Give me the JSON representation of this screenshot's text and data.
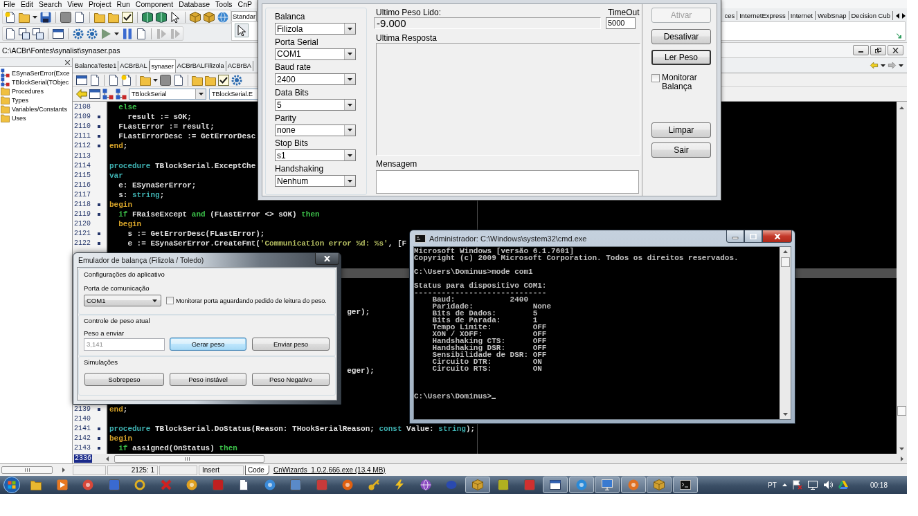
{
  "ide": {
    "menu": [
      "File",
      "Edit",
      "Search",
      "View",
      "Project",
      "Run",
      "Component",
      "Database",
      "Tools",
      "CnP"
    ],
    "palette": {
      "tabs_left": [
        {
          "label": "Standar",
          "selected": true
        }
      ],
      "tabs_right": [
        {
          "label": "ces",
          "selected": false
        },
        {
          "label": "InternetExpress",
          "selected": false
        },
        {
          "label": "Internet",
          "selected": false
        },
        {
          "label": "WebSnap",
          "selected": false
        },
        {
          "label": "Decision Cub",
          "selected": false
        }
      ]
    },
    "file_path": "C:\\ACBr\\Fontes\\synalist\\synaser.pas",
    "explorer_items": [
      {
        "label": "ESynaSerError(Exce",
        "kind": "class"
      },
      {
        "label": "TBlockSerial(TObjec",
        "kind": "class"
      },
      {
        "label": "Procedures",
        "kind": "folder"
      },
      {
        "label": "Types",
        "kind": "folder"
      },
      {
        "label": "Variables/Constants",
        "kind": "folder"
      },
      {
        "label": "Uses",
        "kind": "folder"
      }
    ],
    "editor_tabs": [
      {
        "label": "BalancaTeste1",
        "selected": false
      },
      {
        "label": "ACBrBAL",
        "selected": false
      },
      {
        "label": "synaser",
        "selected": true
      },
      {
        "label": "ACBrBALFilizola",
        "selected": false
      },
      {
        "label": "ACBrBA",
        "selected": false
      }
    ],
    "class_combo": "TBlockSerial",
    "method_combo": "TBlockSerial.E",
    "code": {
      "lines": [
        {
          "number": "2108",
          "marked": false,
          "current": false,
          "tokens": [
            {
              "text": "  else",
              "kind": "keyword"
            }
          ]
        },
        {
          "number": "2109",
          "marked": true,
          "current": false,
          "tokens": [
            {
              "text": "    result := sOK;",
              "kind": "plain"
            }
          ]
        },
        {
          "number": "2110",
          "marked": true,
          "current": false,
          "tokens": [
            {
              "text": "  FLastError := result;",
              "kind": "plain"
            }
          ]
        },
        {
          "number": "2111",
          "marked": true,
          "current": false,
          "tokens": [
            {
              "text": "  FLastErrorDesc := GetErrorDesc",
              "kind": "plain"
            }
          ]
        },
        {
          "number": "2112",
          "marked": true,
          "current": false,
          "tokens": [
            {
              "text": "end",
              "kind": "block"
            },
            {
              "text": ";",
              "kind": "plain"
            }
          ]
        },
        {
          "number": "2113",
          "marked": false,
          "current": false
        },
        {
          "number": "2114",
          "marked": false,
          "current": false,
          "tokens": [
            {
              "text": "procedure",
              "kind": "declaration"
            },
            {
              "text": " TBlockSerial.ExceptChe",
              "kind": "plain"
            }
          ]
        },
        {
          "number": "2115",
          "marked": false,
          "current": false,
          "tokens": [
            {
              "text": "var",
              "kind": "declaration"
            }
          ]
        },
        {
          "number": "2116",
          "marked": false,
          "current": false,
          "tokens": [
            {
              "text": "  e: ESynaSerError;",
              "kind": "plain"
            }
          ]
        },
        {
          "number": "2117",
          "marked": false,
          "current": false,
          "tokens": [
            {
              "text": "  s: ",
              "kind": "plain"
            },
            {
              "text": "string",
              "kind": "declaration"
            },
            {
              "text": ";",
              "kind": "plain"
            }
          ]
        },
        {
          "number": "2118",
          "marked": true,
          "current": false,
          "tokens": [
            {
              "text": "begin",
              "kind": "block"
            }
          ]
        },
        {
          "number": "2119",
          "marked": true,
          "current": false,
          "tokens": [
            {
              "text": "  if",
              "kind": "keyword"
            },
            {
              "text": " FRaiseExcept ",
              "kind": "plain"
            },
            {
              "text": "and",
              "kind": "keyword"
            },
            {
              "text": " (FLastError <> sOK) ",
              "kind": "plain"
            },
            {
              "text": "then",
              "kind": "keyword"
            }
          ]
        },
        {
          "number": "2120",
          "marked": false,
          "current": false,
          "tokens": [
            {
              "text": "  begin",
              "kind": "block"
            }
          ]
        },
        {
          "number": "2121",
          "marked": true,
          "current": false,
          "tokens": [
            {
              "text": "    s := GetErrorDesc(FLastError);",
              "kind": "plain"
            }
          ]
        },
        {
          "number": "2122",
          "marked": true,
          "current": false,
          "tokens": [
            {
              "text": "    e := ESynaSerError.CreateFmt(",
              "kind": "plain"
            },
            {
              "text": "'Communication error %d: %s'",
              "kind": "string"
            },
            {
              "text": ", [F",
              "kind": "plain"
            }
          ]
        },
        {
          "current": false
        },
        {
          "current": false
        },
        {
          "current": true
        },
        {
          "current": false
        },
        {
          "current": false
        },
        {
          "current": false
        },
        {
          "current": false,
          "tokens": [
            {
              "text": "                                                    ger);",
              "kind": "plain"
            }
          ]
        },
        {
          "current": false
        },
        {
          "current": false
        },
        {
          "current": false
        },
        {
          "current": false
        },
        {
          "current": false
        },
        {
          "current": false,
          "tokens": [
            {
              "text": "                                                    eger);",
              "kind": "plain"
            }
          ]
        },
        {
          "current": false
        },
        {
          "current": false
        },
        {
          "current": false
        },
        {
          "number": "2139",
          "marked": true,
          "current": false,
          "tokens": [
            {
              "text": "end",
              "kind": "block"
            },
            {
              "text": ";",
              "kind": "plain"
            }
          ]
        },
        {
          "number": "2140",
          "marked": false,
          "current": false
        },
        {
          "number": "2141",
          "marked": true,
          "current": false,
          "tokens": [
            {
              "text": "procedure",
              "kind": "declaration"
            },
            {
              "text": " TBlockSerial.DoStatus(Reason: THookSerialReason; ",
              "kind": "plain"
            },
            {
              "text": "const",
              "kind": "declaration"
            },
            {
              "text": " Value: ",
              "kind": "plain"
            },
            {
              "text": "string",
              "kind": "declaration"
            },
            {
              "text": ");",
              "kind": "plain"
            }
          ]
        },
        {
          "number": "2142",
          "marked": true,
          "current": false,
          "tokens": [
            {
              "text": "begin",
              "kind": "block"
            }
          ]
        },
        {
          "number": "2143",
          "marked": true,
          "current": false,
          "tokens": [
            {
              "text": "  if",
              "kind": "keyword"
            },
            {
              "text": " assigned(OnStatus) ",
              "kind": "plain"
            },
            {
              "text": "then",
              "kind": "keyword"
            }
          ]
        }
      ],
      "line_count": "2336"
    },
    "status_bar": {
      "position": "2125: 1",
      "mode": "Insert",
      "view_tab": "Code",
      "message": "CnWizards_1.0.2.666.exe (13.4 MB)"
    }
  },
  "balance_dialog": {
    "settings": [
      {
        "label": "Balanca",
        "value": "Filizola"
      },
      {
        "label": "Porta Serial",
        "value": "COM1"
      },
      {
        "label": "Baud rate",
        "value": "2400"
      },
      {
        "label": "Data Bits",
        "value": "5"
      },
      {
        "label": "Parity",
        "value": "none"
      },
      {
        "label": "Stop Bits",
        "value": "s1"
      },
      {
        "label": "Handshaking",
        "value": "Nenhum"
      }
    ],
    "last_weight": {
      "label": "Ultimo Peso Lido:",
      "value": "-9.000"
    },
    "timeout": {
      "label": "TimeOut",
      "value": "5000"
    },
    "last_response": {
      "label": "Ultima Resposta"
    },
    "message": {
      "label": "Mensagem"
    },
    "actions": [
      {
        "label": "Ativar",
        "disabled": true,
        "focused": false
      },
      {
        "label": "Desativar",
        "disabled": false,
        "focused": false
      },
      {
        "label": "Ler Peso",
        "disabled": false,
        "focused": true
      }
    ],
    "monitor": {
      "label": "Monitorar Balança",
      "checked": false
    },
    "bottom_actions": [
      {
        "label": "Limpar",
        "disabled": false,
        "focused": false
      },
      {
        "label": "Sair",
        "disabled": false,
        "focused": false
      }
    ]
  },
  "emulator": {
    "title": "Emulador de balança (Filizola / Toledo)",
    "app_settings": {
      "title": "Configurações do aplicativo",
      "port_label": "Porta de comunicação",
      "port": "COM1",
      "monitor": {
        "label": "Monitorar porta aguardando pedido de leitura do peso.",
        "checked": false
      }
    },
    "weight_control": {
      "title": "Controle de peso atual",
      "weight_label": "Peso a enviar",
      "weight": {
        "placeholder": "3,141"
      },
      "buttons": [
        {
          "label": "Gerar peso",
          "focused": true
        },
        {
          "label": "Enviar peso",
          "focused": false
        }
      ]
    },
    "simulations": {
      "title": "Simulações",
      "buttons": [
        {
          "label": "Sobrepeso",
          "focused": false
        },
        {
          "label": "Peso instável",
          "focused": false
        },
        {
          "label": "Peso Negativo",
          "focused": false
        }
      ]
    }
  },
  "console": {
    "title": "Administrador: C:\\Windows\\system32\\cmd.exe",
    "blocks": [
      [
        "Microsoft Windows [versão 6.1.7601]",
        "Copyright (c) 2009 Microsoft Corporation. Todos os direitos reservados."
      ],
      [
        "C:\\Users\\Dominus>mode com1"
      ],
      [
        "Status para dispositivo COM1:",
        "-----------------------------",
        "    Baud:            2400",
        "    Paridade:             None",
        "    Bits de Dados:        5",
        "    Bits de Parada:       1",
        "    Tempo Limite:         OFF",
        "    XON / XOFF:           OFF",
        "    Handshaking CTS:      OFF",
        "    Handshaking DSR:      OFF",
        "    Sensibilidade de DSR: OFF",
        "    Circuito DTR:         ON",
        "    Circuito RTS:         ON"
      ]
    ],
    "prompt": "C:\\Users\\Dominus>"
  },
  "taskbar": {
    "apps": [
      {
        "open": false
      },
      {
        "open": false
      },
      {
        "open": false
      },
      {
        "open": false
      },
      {
        "open": false
      },
      {
        "open": false
      },
      {
        "open": false
      },
      {
        "open": false
      },
      {
        "open": false
      },
      {
        "open": false
      },
      {
        "open": false
      },
      {
        "open": false
      },
      {
        "open": false
      },
      {
        "open": false
      },
      {
        "open": false
      },
      {
        "open": false
      },
      {
        "open": false
      },
      {
        "open": true
      },
      {
        "open": false
      },
      {
        "open": false
      },
      {
        "open": true
      },
      {
        "open": true
      },
      {
        "open": true
      },
      {
        "open": true
      },
      {
        "open": true
      },
      {
        "open": true
      }
    ],
    "language": "PT",
    "clock": "00:18"
  }
}
